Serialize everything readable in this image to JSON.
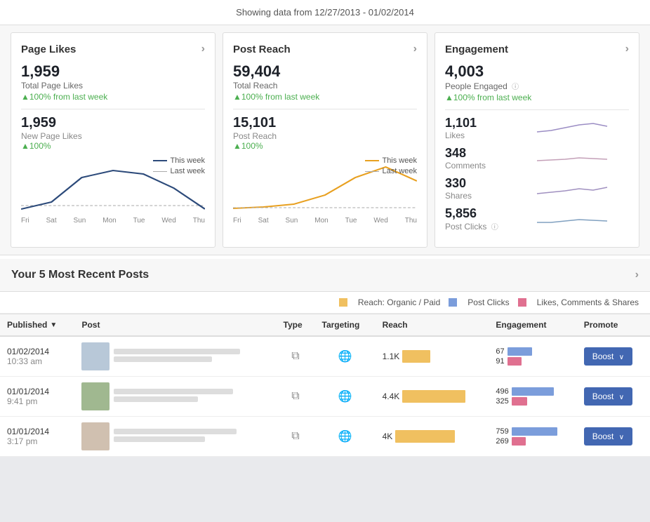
{
  "header": {
    "date_range_label": "Showing data from 12/27/2013 - 01/02/2014"
  },
  "page_likes_card": {
    "title": "Page Likes",
    "total_likes": "1,959",
    "total_likes_label": "Total Page Likes",
    "total_change": "▲100% from last week",
    "new_likes": "1,959",
    "new_likes_label": "New Page Likes",
    "new_change": "▲100%",
    "legend_this_week": "This week",
    "legend_last_week": "Last week",
    "x_labels": [
      "Fri",
      "Sat",
      "Sun",
      "Mon",
      "Tue",
      "Wed",
      "Thu"
    ]
  },
  "post_reach_card": {
    "title": "Post Reach",
    "total_reach": "59,404",
    "total_reach_label": "Total Reach",
    "total_change": "▲100% from last week",
    "post_reach": "15,101",
    "post_reach_label": "Post Reach",
    "post_change": "▲100%",
    "legend_this_week": "This week",
    "legend_last_week": "Last week",
    "x_labels": [
      "Fri",
      "Sat",
      "Sun",
      "Mon",
      "Tue",
      "Wed",
      "Thu"
    ]
  },
  "engagement_card": {
    "title": "Engagement",
    "people_engaged": "4,003",
    "people_engaged_label": "People Engaged",
    "people_change": "▲100% from last week",
    "metrics": [
      {
        "value": "1,101",
        "label": "Likes"
      },
      {
        "value": "348",
        "label": "Comments"
      },
      {
        "value": "330",
        "label": "Shares"
      },
      {
        "value": "5,856",
        "label": "Post Clicks"
      }
    ]
  },
  "recent_posts": {
    "title": "Your 5 Most Recent Posts",
    "legend": [
      {
        "color": "#f0c060",
        "label": "Reach: Organic / Paid"
      },
      {
        "color": "#7b9ddb",
        "label": "Post Clicks"
      },
      {
        "color": "#e07090",
        "label": "Likes, Comments & Shares"
      }
    ],
    "columns": [
      "Published",
      "Post",
      "Type",
      "Targeting",
      "Reach",
      "Engagement",
      "Promote"
    ],
    "rows": [
      {
        "date": "01/02/2014",
        "time": "10:33 am",
        "reach_value": "1.1K",
        "reach_width": 40,
        "eng_top": "67",
        "eng_bot": "91",
        "eng_top_width": 35,
        "eng_bot_width": 20,
        "boost_label": "Boost ∨"
      },
      {
        "date": "01/01/2014",
        "time": "9:41 pm",
        "reach_value": "4.4K",
        "reach_width": 90,
        "eng_top": "496",
        "eng_bot": "325",
        "eng_top_width": 60,
        "eng_bot_width": 22,
        "boost_label": "Boost ∨"
      },
      {
        "date": "01/01/2014",
        "time": "3:17 pm",
        "reach_value": "4K",
        "reach_width": 85,
        "eng_top": "759",
        "eng_bot": "269",
        "eng_top_width": 65,
        "eng_bot_width": 20,
        "boost_label": "Boost ∨"
      }
    ]
  }
}
